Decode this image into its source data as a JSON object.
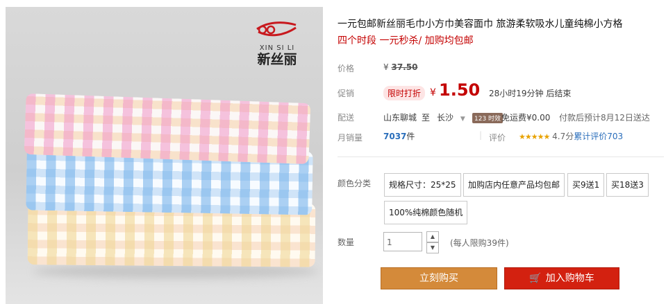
{
  "brand": {
    "name_en": "XIN SI LI",
    "name_cn": "新丝丽"
  },
  "product": {
    "title": "一元包邮新丝丽毛巾小方巾美容面巾 旅游柔软吸水儿童纯棉小方格",
    "promo": "四个时段 一元秒杀/ 加购均包邮"
  },
  "labels": {
    "price": "价格",
    "promo": "促销",
    "delivery": "配送",
    "monthly_sales": "月销量",
    "rating": "评价",
    "color": "颜色分类",
    "quantity": "数量"
  },
  "price": {
    "currency": "¥",
    "original": "37.50",
    "current": "1.50"
  },
  "promotion": {
    "tag": "限时打折",
    "countdown": "28小时19分钟 后结束"
  },
  "delivery": {
    "from": "山东聊城",
    "to_label": "至",
    "destination": "长沙",
    "badge": "123 时效",
    "shipping": "免运费¥0.00",
    "eta": "付款后预计8月12日送达"
  },
  "sales": {
    "count": "7037",
    "unit": "件"
  },
  "rating": {
    "stars": 4.7,
    "score": "4.7分",
    "reviews_label": "累计评价",
    "reviews_count": "703"
  },
  "options": [
    "规格尺寸：25*25",
    "加购店内任意产品均包邮",
    "买9送1",
    "买18送3",
    "100%纯棉颜色随机"
  ],
  "quantity": {
    "value": "1",
    "limit": "(每人限购39件)"
  },
  "buttons": {
    "buy_now": "立刻购买",
    "add_to_cart": "加入购物车"
  },
  "colors": {
    "price_red": "#c40000",
    "buy_orange": "#d48a3a",
    "cart_red": "#d32110",
    "star": "#e8a200"
  }
}
